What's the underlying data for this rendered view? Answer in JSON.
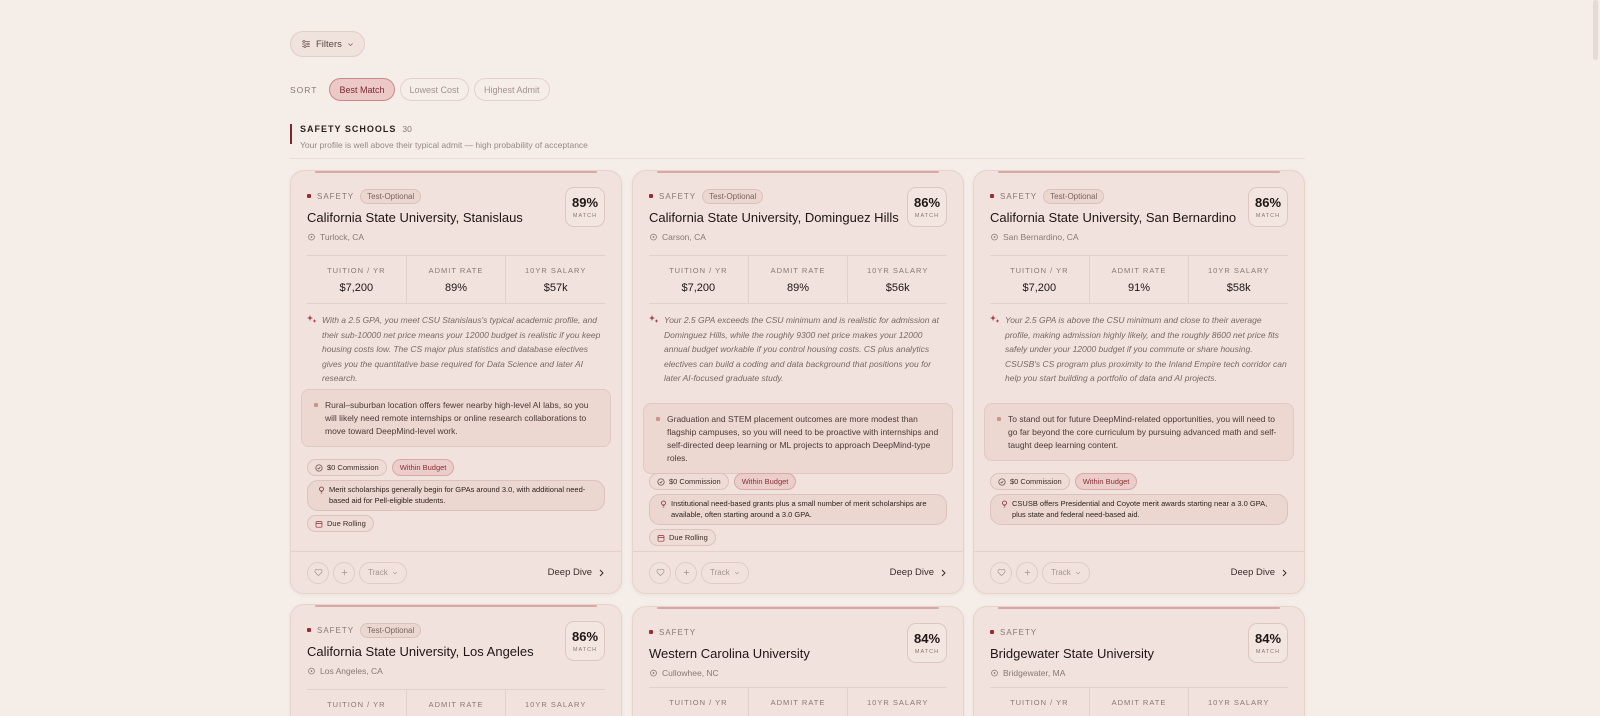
{
  "filters_label": "Filters",
  "sort": {
    "label": "SORT",
    "options": [
      "Best Match",
      "Lowest Cost",
      "Highest Admit"
    ],
    "active": "Best Match"
  },
  "section": {
    "title": "SAFETY SCHOOLS",
    "count": "30",
    "subtitle": "Your profile is well above their typical admit — high probability of acceptance"
  },
  "labels": {
    "tuition": "TUITION / YR",
    "admit": "ADMIT RATE",
    "salary": "10YR SALARY",
    "match": "MATCH",
    "safety": "SAFETY",
    "track": "Track",
    "deep_dive": "Deep Dive"
  },
  "cards": [
    {
      "tier": "SAFETY",
      "tag": "Test-Optional",
      "name": "California State University, Stanislaus",
      "location": "Turlock, CA",
      "match": "89%",
      "tuition": "$7,200",
      "admit": "89%",
      "salary": "$57k",
      "description": "With a 2.5 GPA, you meet CSU Stanislaus's typical academic profile, and their sub-10000 net price means your 12000 budget is realistic if you keep housing costs low. The CS major plus statistics and database electives gives you the quantitative base required for Data Science and later AI research.",
      "note": "Rural–suburban location offers fewer nearby high-level AI labs, so you will likely need remote internships or online research collaborations to move toward DeepMind-level work.",
      "chip_commission": "$0 Commission",
      "chip_budget": "Within Budget",
      "aid": "Merit scholarships generally begin for GPAs around 3.0, with additional need-based aid for Pell-eligible students.",
      "due": "Due Rolling"
    },
    {
      "tier": "SAFETY",
      "tag": "Test-Optional",
      "name": "California State University, Dominguez Hills",
      "location": "Carson, CA",
      "match": "86%",
      "tuition": "$7,200",
      "admit": "89%",
      "salary": "$56k",
      "description": "Your 2.5 GPA exceeds the CSU minimum and is realistic for admission at Dominguez Hills, while the roughly 9300 net price makes your 12000 annual budget workable if you control housing costs. CS plus analytics electives can build a coding and data background that positions you for later AI-focused graduate study.",
      "note": "Graduation and STEM placement outcomes are more modest than flagship campuses, so you will need to be proactive with internships and self-directed deep learning or ML projects to approach DeepMind-type roles.",
      "chip_commission": "$0 Commission",
      "chip_budget": "Within Budget",
      "aid": "Institutional need-based grants plus a small number of merit scholarships are available, often starting around a 3.0 GPA.",
      "due": "Due Rolling"
    },
    {
      "tier": "SAFETY",
      "tag": "Test-Optional",
      "name": "California State University, San Bernardino",
      "location": "San Bernardino, CA",
      "match": "86%",
      "tuition": "$7,200",
      "admit": "91%",
      "salary": "$58k",
      "description": "Your 2.5 GPA is above the CSU minimum and close to their average profile, making admission highly likely, and the roughly 8600 net price fits safely under your 12000 budget if you commute or share housing. CSUSB's CS program plus proximity to the Inland Empire tech corridor can help you start building a portfolio of data and AI projects.",
      "note": "To stand out for future DeepMind-related opportunities, you will need to go far beyond the core curriculum by pursuing advanced math and self-taught deep learning content.",
      "chip_commission": "$0 Commission",
      "chip_budget": "Within Budget",
      "aid": "CSUSB offers Presidential and Coyote merit awards starting near a 3.0 GPA, plus state and federal need-based aid.",
      "due": ""
    },
    {
      "tier": "SAFETY",
      "tag": "Test-Optional",
      "name": "California State University, Los Angeles",
      "location": "Los Angeles, CA",
      "match": "86%"
    },
    {
      "tier": "SAFETY",
      "tag": "",
      "name": "Western Carolina University",
      "location": "Cullowhee, NC",
      "match": "84%"
    },
    {
      "tier": "SAFETY",
      "tag": "",
      "name": "Bridgewater State University",
      "location": "Bridgewater, MA",
      "match": "84%"
    }
  ]
}
